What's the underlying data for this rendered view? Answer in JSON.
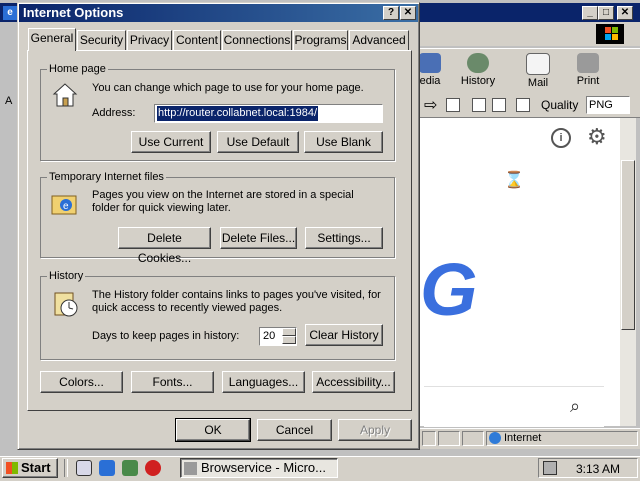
{
  "browser": {
    "menu_right_icon": "windows-logo-icon",
    "toolbar": [
      {
        "label": "Media",
        "display": "edia",
        "icon": "media-icon"
      },
      {
        "label": "History",
        "icon": "history-icon"
      },
      {
        "label": "Mail",
        "icon": "mail-icon"
      },
      {
        "label": "Print",
        "icon": "printer-icon"
      }
    ],
    "quality_label": "Quality",
    "quality_value": "PNG",
    "big_letter": "G",
    "status_zone": "Internet",
    "left_address_letter": "A"
  },
  "dialog": {
    "title": "Internet Options",
    "help_glyph": "?",
    "close_glyph": "✕",
    "tabs": [
      {
        "label": "General",
        "active": true
      },
      {
        "label": "Security"
      },
      {
        "label": "Privacy"
      },
      {
        "label": "Content"
      },
      {
        "label": "Connections"
      },
      {
        "label": "Programs"
      },
      {
        "label": "Advanced"
      }
    ],
    "home_page": {
      "title": "Home page",
      "description": "You can change which page to use for your home page.",
      "address_label": "Address:",
      "address_value": "http://router.collabnet.local:1984/",
      "buttons": [
        "Use Current",
        "Use Default",
        "Use Blank"
      ]
    },
    "temp_files": {
      "title": "Temporary Internet files",
      "description": "Pages you view on the Internet are stored in a special folder for quick viewing later.",
      "buttons": [
        "Delete Cookies...",
        "Delete Files...",
        "Settings..."
      ]
    },
    "history": {
      "title": "History",
      "description": "The History folder contains links to pages you've visited, for quick access to recently viewed pages.",
      "days_label": "Days to keep pages in history:",
      "days_value": "20",
      "clear_button": "Clear History"
    },
    "bottom_buttons": [
      "Colors...",
      "Fonts...",
      "Languages...",
      "Accessibility..."
    ],
    "ok": "OK",
    "cancel": "Cancel",
    "apply": "Apply"
  },
  "taskbar": {
    "start": "Start",
    "task_label": "Browservice - Micro...",
    "clock": "3:13 AM"
  }
}
